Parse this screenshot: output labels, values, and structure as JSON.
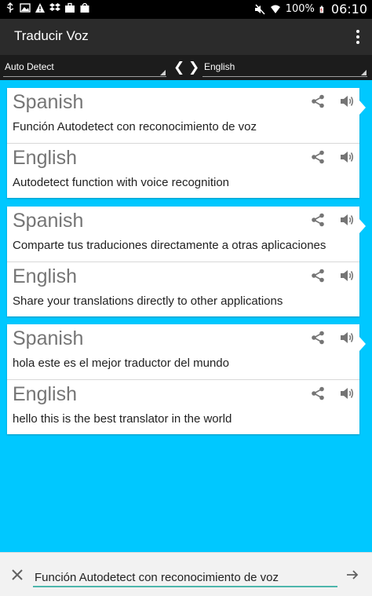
{
  "status_bar": {
    "battery_percent": "100%",
    "time": "06:10"
  },
  "app_bar": {
    "title": "Traducir Voz"
  },
  "language_bar": {
    "source_language": "Auto Detect",
    "target_language": "English",
    "prev_glyph": "❮",
    "next_glyph": "❯"
  },
  "cards": [
    {
      "rows": [
        {
          "language": "Spanish",
          "text": "Función Autodetect con reconocimiento de voz"
        },
        {
          "language": "English",
          "text": "Autodetect function with voice recognition"
        }
      ]
    },
    {
      "rows": [
        {
          "language": "Spanish",
          "text": "Comparte tus traduciones directamente a otras aplicaciones"
        },
        {
          "language": "English",
          "text": "Share your translations directly to other applications"
        }
      ]
    },
    {
      "rows": [
        {
          "language": "Spanish",
          "text": "hola este es el mejor traductor del mundo"
        },
        {
          "language": "English",
          "text": "hello this is the best translator in the world"
        }
      ]
    }
  ],
  "input_bar": {
    "value": "Función Autodetect con reconocimiento de voz"
  },
  "colors": {
    "background_accent": "#00c8ff",
    "app_bar": "#2b2b2b",
    "input_underline": "#4db6ac"
  },
  "icons": [
    "usb-icon",
    "image-icon",
    "warning-icon",
    "dropbox-icon",
    "briefcase-icon",
    "shopping-bag-icon",
    "mute-icon",
    "wifi-icon",
    "battery-icon",
    "share-icon",
    "speaker-icon",
    "clear-icon",
    "send-arrow-icon",
    "overflow-menu-icon"
  ]
}
